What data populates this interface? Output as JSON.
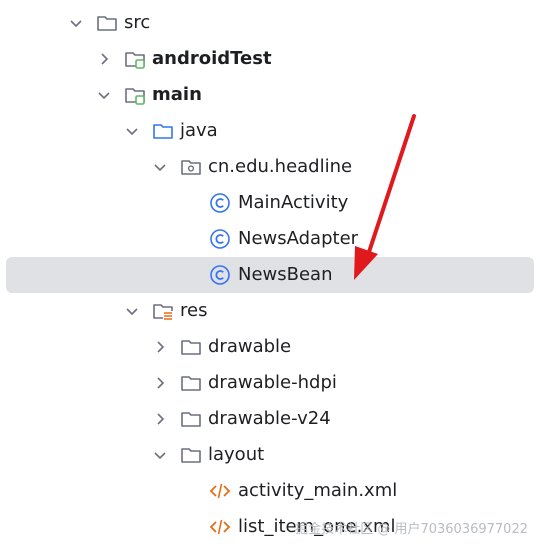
{
  "tree": {
    "src": "src",
    "android_test": "androidTest",
    "main": "main",
    "java": "java",
    "package": "cn.edu.headline",
    "main_activity": "MainActivity",
    "news_adapter": "NewsAdapter",
    "news_bean": "NewsBean",
    "res": "res",
    "drawable": "drawable",
    "drawable_hdpi": "drawable-hdpi",
    "drawable_v24": "drawable-v24",
    "layout": "layout",
    "activity_main": "activity_main.xml",
    "list_item_one": "list_item_one.xml"
  },
  "selected_item": "NewsBean",
  "watermark": "掘金技术社区 @ 用户7036036977022",
  "colors": {
    "selection": "#dfe1e5",
    "class_icon": "#3574f0",
    "folder_icon": "#6c707e",
    "source_folder_icon": "#3574f0",
    "resource_badge": "#e66d17",
    "module_badge": "#5fb865",
    "xml_icon": "#e66d17",
    "arrow": "#e0191c"
  }
}
